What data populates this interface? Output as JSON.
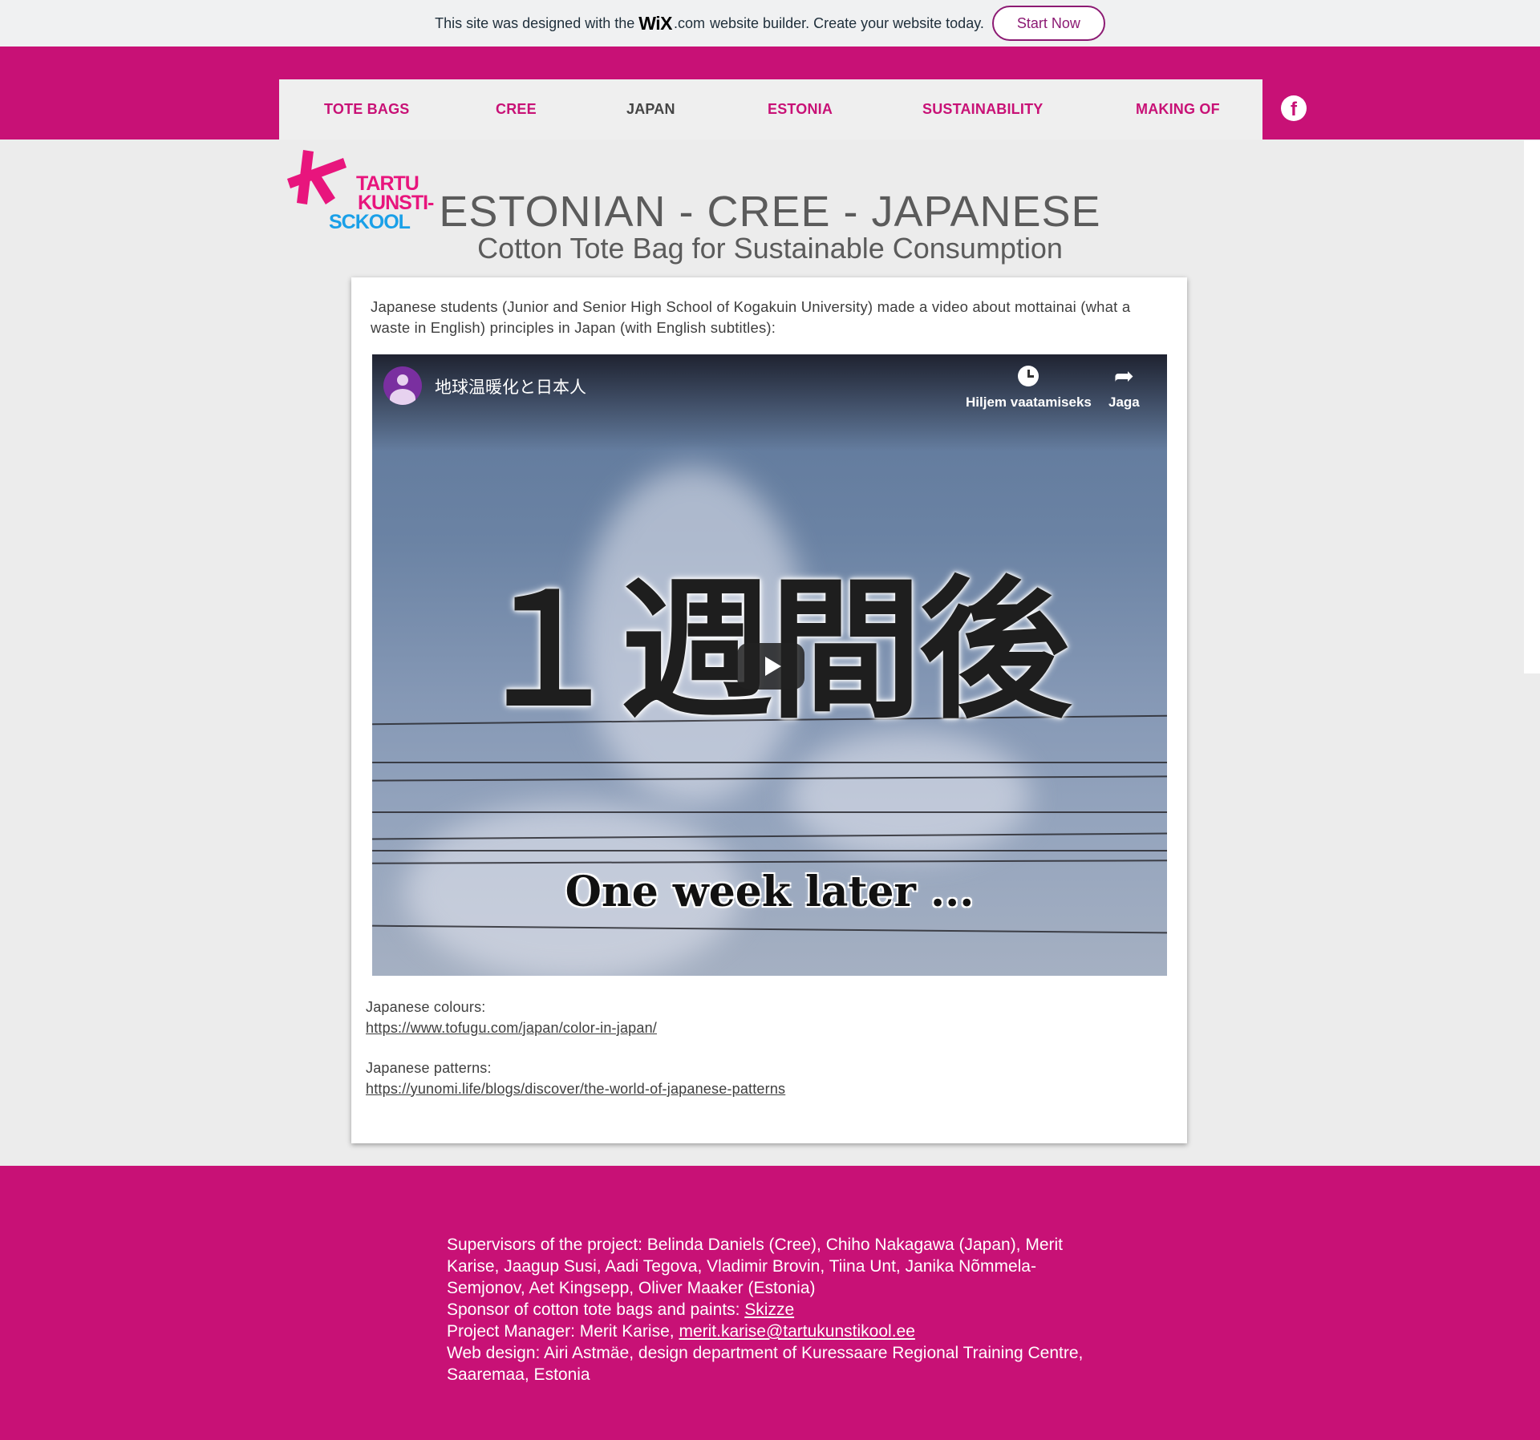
{
  "wix_banner": {
    "text_before": "This site was designed with the",
    "logo": "WiX",
    "dotcom": ".com",
    "text_after": "website builder. Create your website today.",
    "button": "Start Now"
  },
  "nav": {
    "items": [
      "TOTE BAGS",
      "CREE",
      "JAPAN",
      "ESTONIA",
      "SUSTAINABILITY",
      "MAKING OF"
    ],
    "active": "JAPAN",
    "social_icon": "facebook-icon"
  },
  "logo": {
    "line1": "TARTU",
    "line2": "KUNSTI-",
    "line3": "SCKOOL"
  },
  "header": {
    "title": "ESTONIAN - CREE - JAPANESE",
    "subtitle": "Cotton Tote Bag for Sustainable Consumption"
  },
  "content": {
    "intro": "Japanese students (Junior and Senior High School of Kogakuin University) made a video about mottainai (what a waste in English) principles in Japan (with English subtitles):",
    "video": {
      "title": "地球温暖化と日本人",
      "watch_later": "Hiljem vaatamiseks",
      "share": "Jaga",
      "big_text": "１週間後",
      "caption": "One week later ..."
    },
    "colours_label": "Japanese colours:",
    "colours_link": "https://www.tofugu.com/japan/color-in-japan/",
    "patterns_label": "Japanese patterns:",
    "patterns_link": "https://yunomi.life/blogs/discover/the-world-of-japanese-patterns"
  },
  "footer": {
    "supervisors": "Supervisors of the project: Belinda Daniels (Cree), Chiho Nakagawa (Japan), Merit Karise, Jaagup Susi, Aadi Tegova, Vladimir Brovin, Tiina Unt, Janika Nõmmela-Semjonov, Aet Kingsepp, Oliver Maaker (Estonia)",
    "sponsor_label": "Sponsor of cotton tote bags and paints:",
    "sponsor_link": "Skizze",
    "manager_label": "Project Manager: Merit Karise,",
    "manager_email": "merit.karise@tartukunstikool.ee",
    "web_design": "Web design: Airi Astmäe, design department of Kuressaare Regional Training Centre, Saaremaa, Estonia"
  },
  "colors": {
    "brand_magenta": "#c81176",
    "nav_bg": "#efefef",
    "page_bg": "#ececec"
  }
}
